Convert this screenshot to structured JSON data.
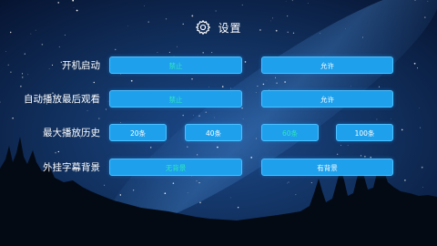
{
  "header": {
    "icon": "gear-icon",
    "title": "设置"
  },
  "rows": [
    {
      "label": "开机启动",
      "options": [
        "禁止",
        "允许"
      ],
      "selected": 0
    },
    {
      "label": "自动播放最后观看",
      "options": [
        "禁止",
        "允许"
      ],
      "selected": 0
    },
    {
      "label": "最大播放历史",
      "options": [
        "20条",
        "40条",
        "60条",
        "100条"
      ],
      "selected": 2
    },
    {
      "label": "外挂字幕背景",
      "options": [
        "无背景",
        "有背景"
      ],
      "selected": 0
    }
  ],
  "colors": {
    "button": "#1ea0ec",
    "selected_text": "#2fe6ba",
    "text": "#ffffff"
  }
}
